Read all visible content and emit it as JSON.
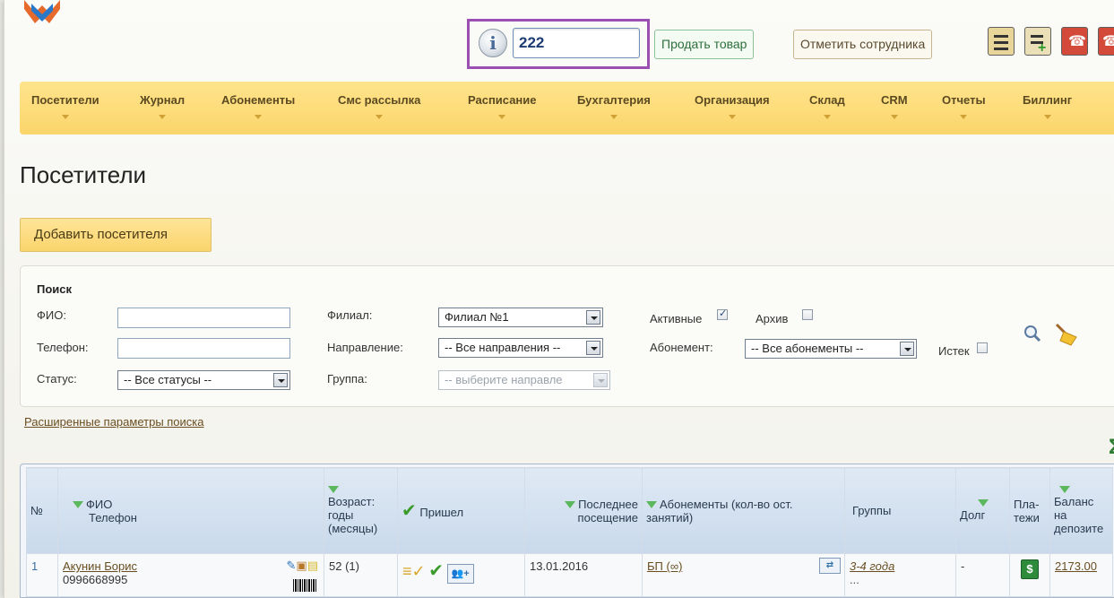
{
  "header": {
    "search_value": "222",
    "sell_button": "Продать товар",
    "mark_employee_button": "Отметить сотрудника",
    "toolbar_icons": [
      "checklist-icon",
      "checklist-add-icon",
      "phone-icon",
      "phone-add-icon"
    ]
  },
  "nav": {
    "items": [
      "Посетители",
      "Журнал",
      "Абонементы",
      "Смс рассылка",
      "Расписание",
      "Бухгалтерия",
      "Организация",
      "Склад",
      "CRM",
      "Отчеты",
      "Биллинг"
    ]
  },
  "page": {
    "title": "Посетители",
    "add_button": "Добавить посетителя"
  },
  "search": {
    "heading": "Поиск",
    "fio_label": "ФИО:",
    "fio_value": "",
    "phone_label": "Телефон:",
    "phone_value": "",
    "status_label": "Статус:",
    "status_value": "-- Все статусы --",
    "branch_label": "Филиал:",
    "branch_value": "Филиал №1",
    "direction_label": "Направление:",
    "direction_value": "-- Все направления --",
    "group_label": "Группа:",
    "group_value": "-- выберите направле",
    "active_label": "Активные",
    "active_checked": true,
    "archive_label": "Архив",
    "archive_checked": false,
    "subscription_label": "Абонемент:",
    "subscription_value": "-- Все абонементы --",
    "expired_label": "Истек",
    "expired_checked": false,
    "advanced_link": "Расширенные параметры поиска"
  },
  "table": {
    "headers": {
      "num": "№",
      "fio_line1": "ФИО",
      "fio_line2": "Телефон",
      "age": "Возраст: годы (месяцы)",
      "came": "Пришел",
      "last_visit": "Последнее посещение",
      "subscriptions": "Абонементы (кол-во ост. занятий)",
      "groups": "Группы",
      "debt": "Долг",
      "payments": "Пла- тежи",
      "balance": "Баланс на депозите"
    },
    "rows": [
      {
        "num": "1",
        "name": "Акунин Борис",
        "phone": "0996668995",
        "age": "52 (1)",
        "last_visit": "13.01.2016",
        "subscription": "БП (∞)",
        "group": "3-4 года",
        "group_more": "...",
        "debt": "-",
        "balance": "2173.00"
      }
    ]
  },
  "colors": {
    "nav_bg": "#fbd56b",
    "highlight_border": "#9b4fb2",
    "header_bg": "#c9d9eb",
    "link_color": "#6a4e21"
  }
}
